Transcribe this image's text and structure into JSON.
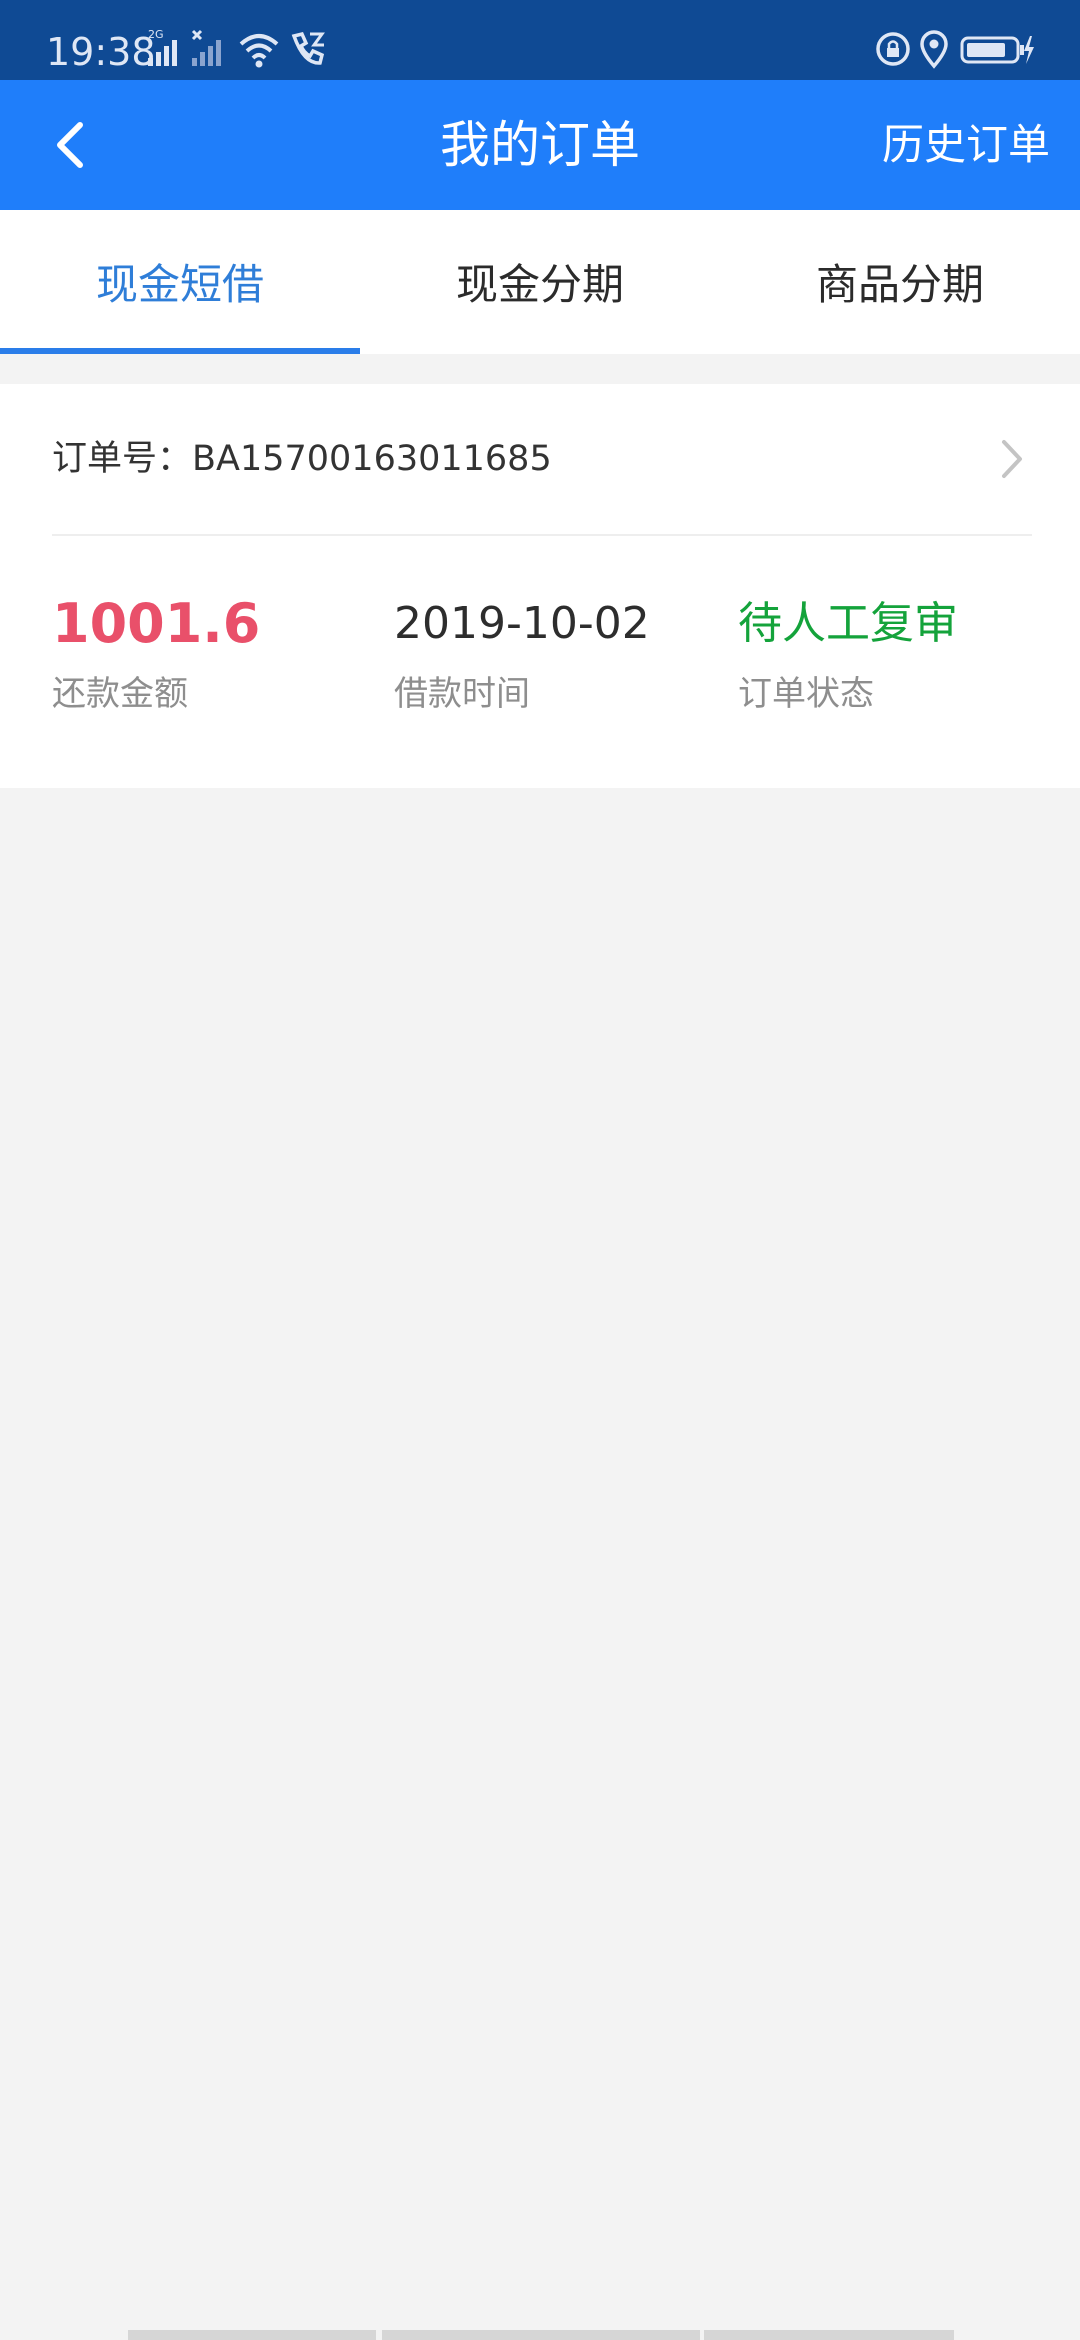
{
  "status_bar": {
    "time": "19:38",
    "network_badge": "2G",
    "icons": [
      "signal-2g-icon",
      "signal-x-icon",
      "wifi-icon",
      "call-icon",
      "lock-rotation-icon",
      "location-icon",
      "battery-charging-icon"
    ]
  },
  "header": {
    "title": "我的订单",
    "history_label": "历史订单",
    "back_icon": "chevron-left-icon",
    "background": "#1f7efa"
  },
  "tabs": [
    {
      "label": "现金短借",
      "active": true
    },
    {
      "label": "现金分期",
      "active": false
    },
    {
      "label": "商品分期",
      "active": false
    }
  ],
  "order": {
    "number_label": "订单号：",
    "number": "BA15700163011685",
    "amount": "1001.6",
    "amount_label": "还款金额",
    "date": "2019-10-02",
    "date_label": "借款时间",
    "status": "待人工复审",
    "status_label": "订单状态"
  },
  "colors": {
    "accent": "#2a7de9",
    "amount": "#e9506a",
    "status": "#14a33b"
  }
}
